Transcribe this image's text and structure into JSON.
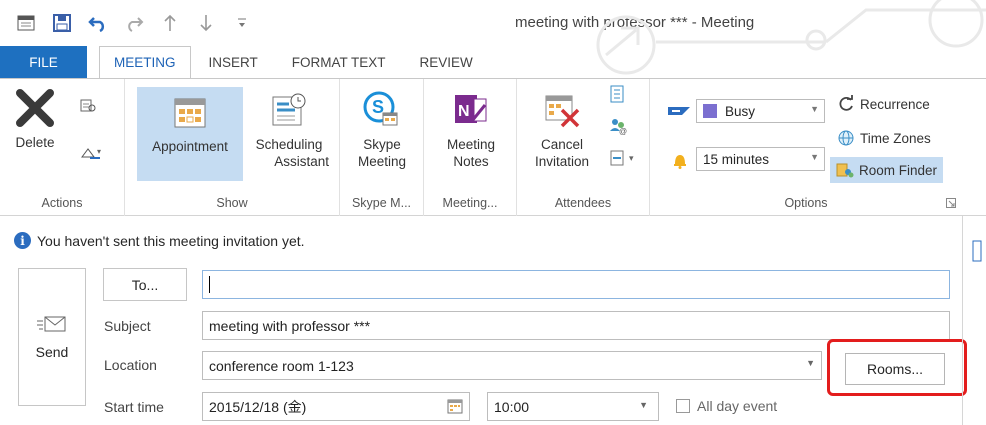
{
  "window": {
    "title": "meeting with professor *** - Meeting"
  },
  "tabs": [
    {
      "label": "FILE"
    },
    {
      "label": "MEETING"
    },
    {
      "label": "INSERT"
    },
    {
      "label": "FORMAT TEXT"
    },
    {
      "label": "REVIEW"
    }
  ],
  "ribbon": {
    "actions": {
      "label": "Actions",
      "delete": "Delete"
    },
    "show": {
      "label": "Show",
      "appointment": "Appointment",
      "scheduling_1": "Scheduling",
      "scheduling_2": "Assistant"
    },
    "skype": {
      "label": "Skype M...",
      "btn_1": "Skype",
      "btn_2": "Meeting"
    },
    "meetingnotes": {
      "label": "Meeting...",
      "btn_1": "Meeting",
      "btn_2": "Notes"
    },
    "attendees": {
      "label": "Attendees",
      "cancel_1": "Cancel",
      "cancel_2": "Invitation"
    },
    "options": {
      "label": "Options",
      "show_as": "Busy",
      "reminder": "15 minutes",
      "recurrence": "Recurrence",
      "time_zones": "Time Zones",
      "room_finder": "Room Finder"
    }
  },
  "info": {
    "message": "You haven't sent this meeting invitation yet."
  },
  "form": {
    "send": "Send",
    "to_button": "To...",
    "subject_label": "Subject",
    "subject_value": "meeting with professor ***",
    "location_label": "Location",
    "location_value": "conference room 1-123",
    "rooms_button": "Rooms...",
    "start_label": "Start time",
    "start_date": "2015/12/18 (金)",
    "start_time": "10:00",
    "all_day": "All day event"
  },
  "colors": {
    "file_tab": "#1e70c0",
    "accent": "#1e63b6",
    "selected": "#c5dcf2",
    "highlight_box": "#e31d1d"
  }
}
